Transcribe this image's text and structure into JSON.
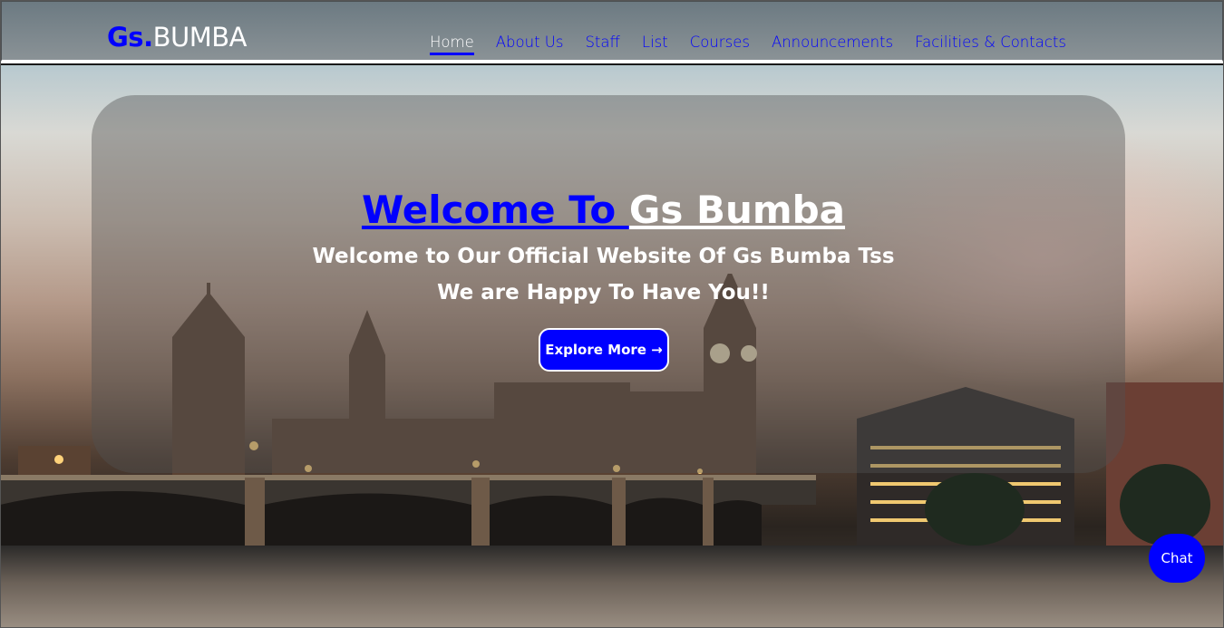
{
  "brand": {
    "prefix": "Gs.",
    "name": "BUMBA"
  },
  "nav": [
    {
      "label": "Home",
      "active": true
    },
    {
      "label": "About Us"
    },
    {
      "label": "Staff"
    },
    {
      "label": "List"
    },
    {
      "label": "Courses"
    },
    {
      "label": "Announcements"
    },
    {
      "label": "Facilities & Contacts"
    }
  ],
  "hero": {
    "title_part1": "Welcome To ",
    "title_part2": "Gs Bumba",
    "subtitle_line1": "Welcome to Our Official Website Of Gs Bumba Tss",
    "subtitle_line2": "We are Happy To Have You!!",
    "button_label": "Explore More →",
    "background_icon": "city-bridge-photo-icon"
  },
  "chat": {
    "label": "Chat"
  },
  "colors": {
    "accent": "#0000ff",
    "text_light": "#ffffff"
  }
}
